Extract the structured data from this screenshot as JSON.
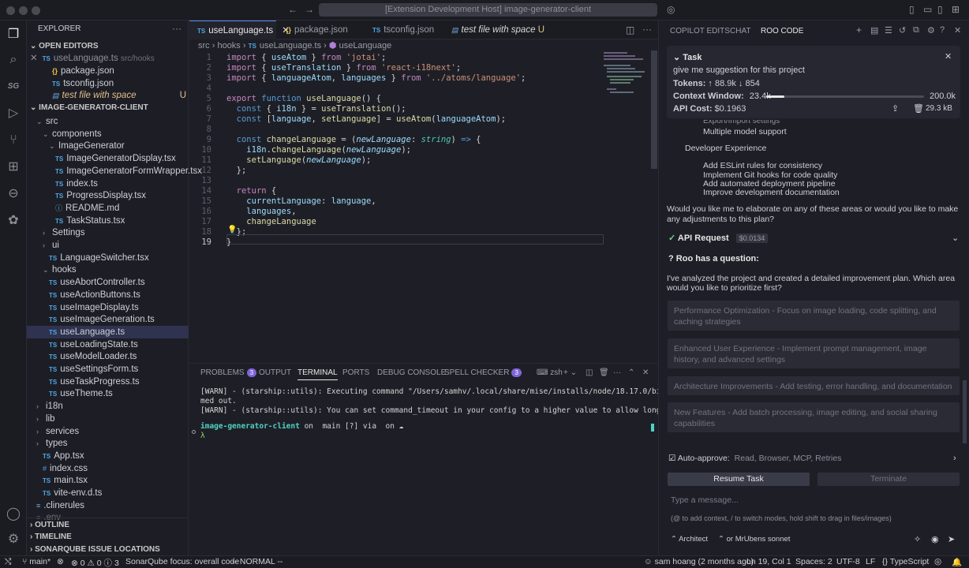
{
  "titlebar": {
    "command_center": "[Extension Development Host] image-generator-client"
  },
  "explorer": {
    "title": "EXPLORER",
    "open_editors": "OPEN EDITORS",
    "open_files": [
      {
        "name": "useLanguage.ts",
        "path": "src/hooks",
        "icon": "TS"
      },
      {
        "name": "package.json",
        "icon": "{}"
      },
      {
        "name": "tsconfig.json",
        "icon": "TS"
      },
      {
        "name": "test file with space",
        "badge": "U"
      }
    ],
    "project": "IMAGE-GENERATOR-CLIENT",
    "tree": [
      "src",
      "components",
      "ImageGenerator",
      "ImageGeneratorDisplay.tsx",
      "ImageGeneratorFormWrapper.tsx",
      "index.ts",
      "ProgressDisplay.tsx",
      "README.md",
      "TaskStatus.tsx",
      "Settings",
      "ui",
      "LanguageSwitcher.tsx",
      "hooks",
      "useAbortController.ts",
      "useActionButtons.ts",
      "useImageDisplay.ts",
      "useImageGeneration.ts",
      "useLanguage.ts",
      "useLoadingState.ts",
      "useModelLoader.ts",
      "useSettingsForm.ts",
      "useTaskProgress.ts",
      "useTheme.ts",
      "i18n",
      "lib",
      "services",
      "types",
      "App.tsx",
      "index.css",
      "main.tsx",
      "vite-env.d.ts",
      ".clinerules",
      ".env"
    ],
    "outline": "OUTLINE",
    "timeline": "TIMELINE",
    "sonar": "SONARQUBE ISSUE LOCATIONS"
  },
  "editor": {
    "tabs": [
      "useLanguage.ts",
      "package.json",
      "tsconfig.json",
      "test file with space"
    ],
    "tab_badge": "U",
    "breadcrumb": [
      "src",
      "hooks",
      "useLanguage.ts",
      "useLanguage"
    ],
    "lines": [
      "1",
      "2",
      "3",
      "4",
      "5",
      "6",
      "7",
      "8",
      "9",
      "10",
      "11",
      "12",
      "13",
      "14",
      "15",
      "16",
      "17",
      "18",
      "19"
    ]
  },
  "panel": {
    "tabs": [
      "PROBLEMS",
      "OUTPUT",
      "TERMINAL",
      "PORTS",
      "DEBUG CONSOLE",
      "SPELL CHECKER"
    ],
    "problems_count": "3",
    "spell_count": "3",
    "shell": "zsh",
    "term_lines": [
      "[WARN] - (starship::utils): Executing command \"/Users/samhv/.local/share/mise/installs/node/18.17.0/bin/node\" ti",
      "med out.",
      "[WARN] - (starship::utils): You can set command_timeout in your config to a higher value to allow longer-running"
    ],
    "prompt_dir": "image-generator-client",
    "prompt_rest": " on  main [?] via  on ☁",
    "prompt_char": "λ"
  },
  "roo": {
    "tabs": [
      "COPILOT EDITS",
      "CHAT",
      "ROO CODE"
    ],
    "task_label": "Task",
    "task_text": "give me suggestion for this project",
    "tokens_label": "Tokens:",
    "tokens_value": "↑ 88.9k ↓ 854",
    "context_label": "Context Window:",
    "context_used": "23.4k",
    "context_total": "200.0k",
    "context_fraction": 0.117,
    "cost_label": "API Cost:",
    "cost_value": "$0.1963",
    "size": "29.3 kB",
    "items_partial": "Export/Import settings",
    "items_1": "Multiple model support",
    "section": "Developer Experience",
    "dev_items": [
      "Add ESLint rules for consistency",
      "Implement Git hooks for code quality",
      "Add automated deployment pipeline",
      "Improve development documentation"
    ],
    "elaborate": "Would you like me to elaborate on any of these areas or would you like to make any adjustments to this plan?",
    "api_request": "API Request",
    "api_cost": "$0.0134",
    "question_label": "Roo has a question:",
    "question": "I've analyzed the project and created a detailed improvement plan. Which area would you like to prioritize first?",
    "options": [
      "Performance Optimization - Focus on image loading, code splitting, and caching strategies",
      "Enhanced User Experience - Implement prompt management, image history, and advanced settings",
      "Architecture Improvements - Add testing, error handling, and documentation",
      "New Features - Add batch processing, image editing, and social sharing capabilities"
    ],
    "auto_approve": "Auto-approve:",
    "auto_approve_items": "Read, Browser, MCP, Retries",
    "resume": "Resume Task",
    "terminate": "Terminate",
    "input_placeholder": "Type a message...",
    "hint": "(@ to add context, / to switch modes, hold shift to drag in files/images)",
    "mode": "Architect",
    "model": "or MrUbens sonnet"
  },
  "status": {
    "branch": "main*",
    "problems": "⊗ 0 ⚠ 0 ⓘ 3",
    "sonar": "SonarQube focus: overall code",
    "vim": "-- NORMAL --",
    "blame": "sam hoang (2 months ago)",
    "position": "Ln 19, Col 1",
    "spaces": "Spaces: 2",
    "encoding": "UTF-8",
    "eol": "LF",
    "lang": "TypeScript"
  },
  "colors": {
    "accent": "#5b8def",
    "badge": "#7f63d8",
    "background": "#1e1f26"
  }
}
